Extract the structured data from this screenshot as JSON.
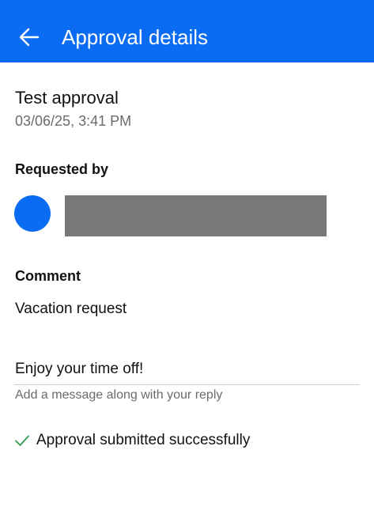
{
  "header": {
    "title": "Approval details",
    "back_icon": "arrow-left-icon",
    "color": "#0a6cf3"
  },
  "approval": {
    "title": "Test approval",
    "timestamp": "03/06/25, 3:41 PM"
  },
  "requested_by": {
    "label": "Requested by",
    "avatar_color": "#0a6cf3"
  },
  "comment": {
    "label": "Comment",
    "text": "Vacation request"
  },
  "reply": {
    "value": "Enjoy your time off!",
    "hint": "Add a message along with your reply"
  },
  "status": {
    "icon": "checkmark-icon",
    "text": "Approval submitted successfully",
    "color": "#2e9e4b"
  }
}
